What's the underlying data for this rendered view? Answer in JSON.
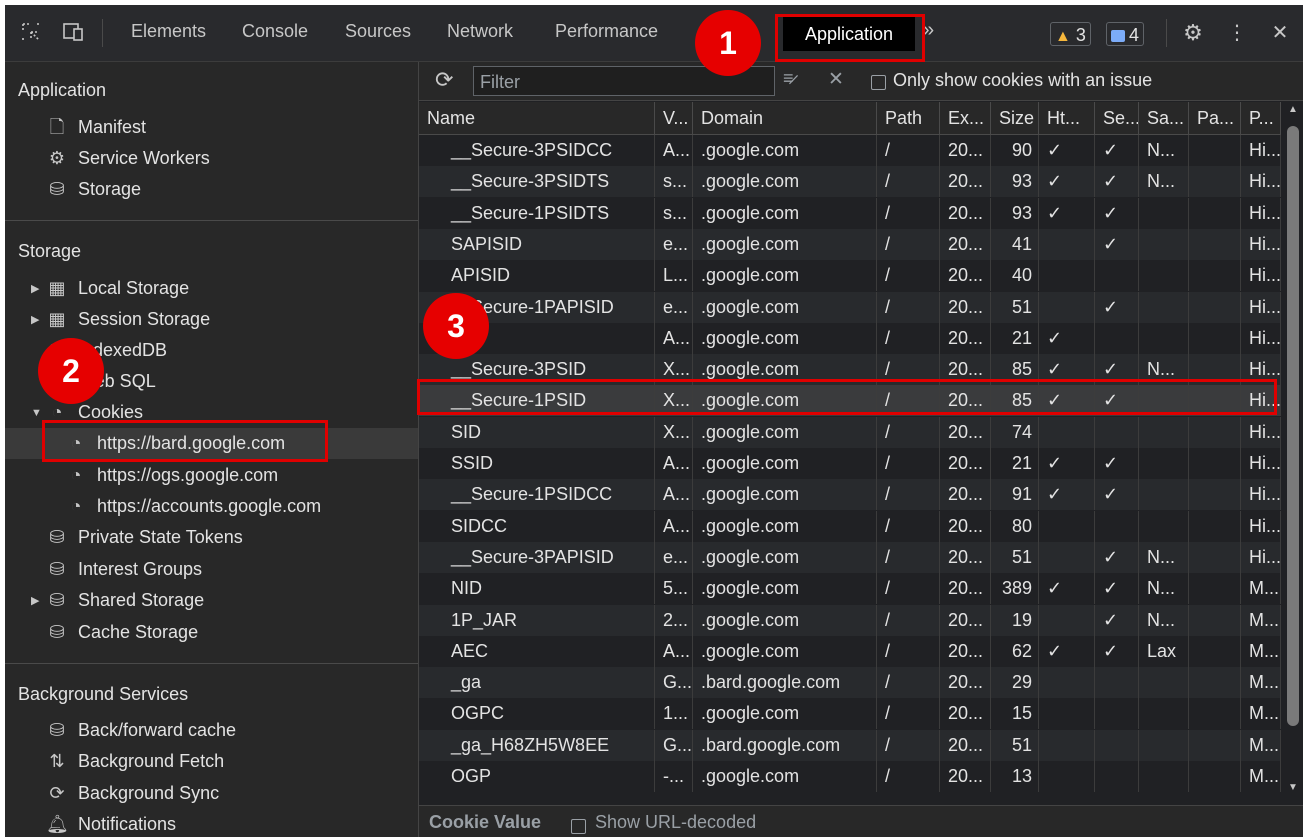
{
  "toolbar": {
    "tabs": [
      "Elements",
      "Console",
      "Sources",
      "Network",
      "Performance"
    ],
    "active_tab": "Application",
    "overflow": "»",
    "warnings_count": "3",
    "messages_count": "4"
  },
  "sidebar": {
    "application_title": "Application",
    "application_items": [
      "Manifest",
      "Service Workers",
      "Storage"
    ],
    "storage_title": "Storage",
    "storage_items": {
      "local_storage": "Local Storage",
      "session_storage": "Session Storage",
      "indexeddb": "IndexedDB",
      "web_sql": "Web SQL",
      "cookies": "Cookies",
      "cookie_origins": [
        "https://bard.google.com",
        "https://ogs.google.com",
        "https://accounts.google.com"
      ],
      "private_state_tokens": "Private State Tokens",
      "interest_groups": "Interest Groups",
      "shared_storage": "Shared Storage",
      "cache_storage": "Cache Storage"
    },
    "background_title": "Background Services",
    "background_items": [
      "Back/forward cache",
      "Background Fetch",
      "Background Sync",
      "Notifications"
    ]
  },
  "cookies_toolbar": {
    "filter_placeholder": "Filter",
    "only_issue_label": "Only show cookies with an issue"
  },
  "table": {
    "columns": [
      "Name",
      "V...",
      "Domain",
      "Path",
      "Ex...",
      "Size",
      "Ht...",
      "Se...",
      "Sa...",
      "Pa...",
      "P..."
    ],
    "rows": [
      [
        "__Secure-3PSIDCC",
        "A...",
        ".google.com",
        "/",
        "20...",
        "90",
        "✓",
        "✓",
        "N...",
        "",
        "Hi..."
      ],
      [
        "__Secure-3PSIDTS",
        "s...",
        ".google.com",
        "/",
        "20...",
        "93",
        "✓",
        "✓",
        "N...",
        "",
        "Hi..."
      ],
      [
        "__Secure-1PSIDTS",
        "s...",
        ".google.com",
        "/",
        "20...",
        "93",
        "✓",
        "✓",
        "",
        "",
        "Hi..."
      ],
      [
        "SAPISID",
        "e...",
        ".google.com",
        "/",
        "20...",
        "41",
        "",
        "✓",
        "",
        "",
        "Hi..."
      ],
      [
        "APISID",
        "L...",
        ".google.com",
        "/",
        "20...",
        "40",
        "",
        "",
        "",
        "",
        "Hi..."
      ],
      [
        "__Secure-1PAPISID",
        "e...",
        ".google.com",
        "/",
        "20...",
        "51",
        "",
        "✓",
        "",
        "",
        "Hi..."
      ],
      [
        "",
        "A...",
        ".google.com",
        "/",
        "20...",
        "21",
        "✓",
        "",
        "",
        "",
        "Hi..."
      ],
      [
        "__Secure-3PSID",
        "X...",
        ".google.com",
        "/",
        "20...",
        "85",
        "✓",
        "✓",
        "N...",
        "",
        "Hi..."
      ],
      [
        "__Secure-1PSID",
        "X...",
        ".google.com",
        "/",
        "20...",
        "85",
        "✓",
        "✓",
        "",
        "",
        "Hi..."
      ],
      [
        "SID",
        "X...",
        ".google.com",
        "/",
        "20...",
        "74",
        "",
        "",
        "",
        "",
        "Hi..."
      ],
      [
        "SSID",
        "A...",
        ".google.com",
        "/",
        "20...",
        "21",
        "✓",
        "✓",
        "",
        "",
        "Hi..."
      ],
      [
        "__Secure-1PSIDCC",
        "A...",
        ".google.com",
        "/",
        "20...",
        "91",
        "✓",
        "✓",
        "",
        "",
        "Hi..."
      ],
      [
        "SIDCC",
        "A...",
        ".google.com",
        "/",
        "20...",
        "80",
        "",
        "",
        "",
        "",
        "Hi..."
      ],
      [
        "__Secure-3PAPISID",
        "e...",
        ".google.com",
        "/",
        "20...",
        "51",
        "",
        "✓",
        "N...",
        "",
        "Hi..."
      ],
      [
        "NID",
        "5...",
        ".google.com",
        "/",
        "20...",
        "389",
        "✓",
        "✓",
        "N...",
        "",
        "M..."
      ],
      [
        "1P_JAR",
        "2...",
        ".google.com",
        "/",
        "20...",
        "19",
        "",
        "✓",
        "N...",
        "",
        "M..."
      ],
      [
        "AEC",
        "A...",
        ".google.com",
        "/",
        "20...",
        "62",
        "✓",
        "✓",
        "Lax",
        "",
        "M..."
      ],
      [
        "_ga",
        "G...",
        ".bard.google.com",
        "/",
        "20...",
        "29",
        "",
        "",
        "",
        "",
        "M..."
      ],
      [
        "OGPC",
        "1...",
        ".google.com",
        "/",
        "20...",
        "15",
        "",
        "",
        "",
        "",
        "M..."
      ],
      [
        "_ga_H68ZH5W8EE",
        "G...",
        ".bard.google.com",
        "/",
        "20...",
        "51",
        "",
        "",
        "",
        "",
        "M..."
      ],
      [
        "OGP",
        "-...",
        ".google.com",
        "/",
        "20...",
        "13",
        "",
        "",
        "",
        "",
        "M..."
      ]
    ],
    "selected_row_index": 8
  },
  "bottom": {
    "cookie_value_label": "Cookie Value",
    "show_url_decoded_label": "Show URL-decoded"
  },
  "annotations": {
    "callout_1": "1",
    "callout_2": "2",
    "callout_3": "3",
    "highlight_color": "#e00000"
  }
}
